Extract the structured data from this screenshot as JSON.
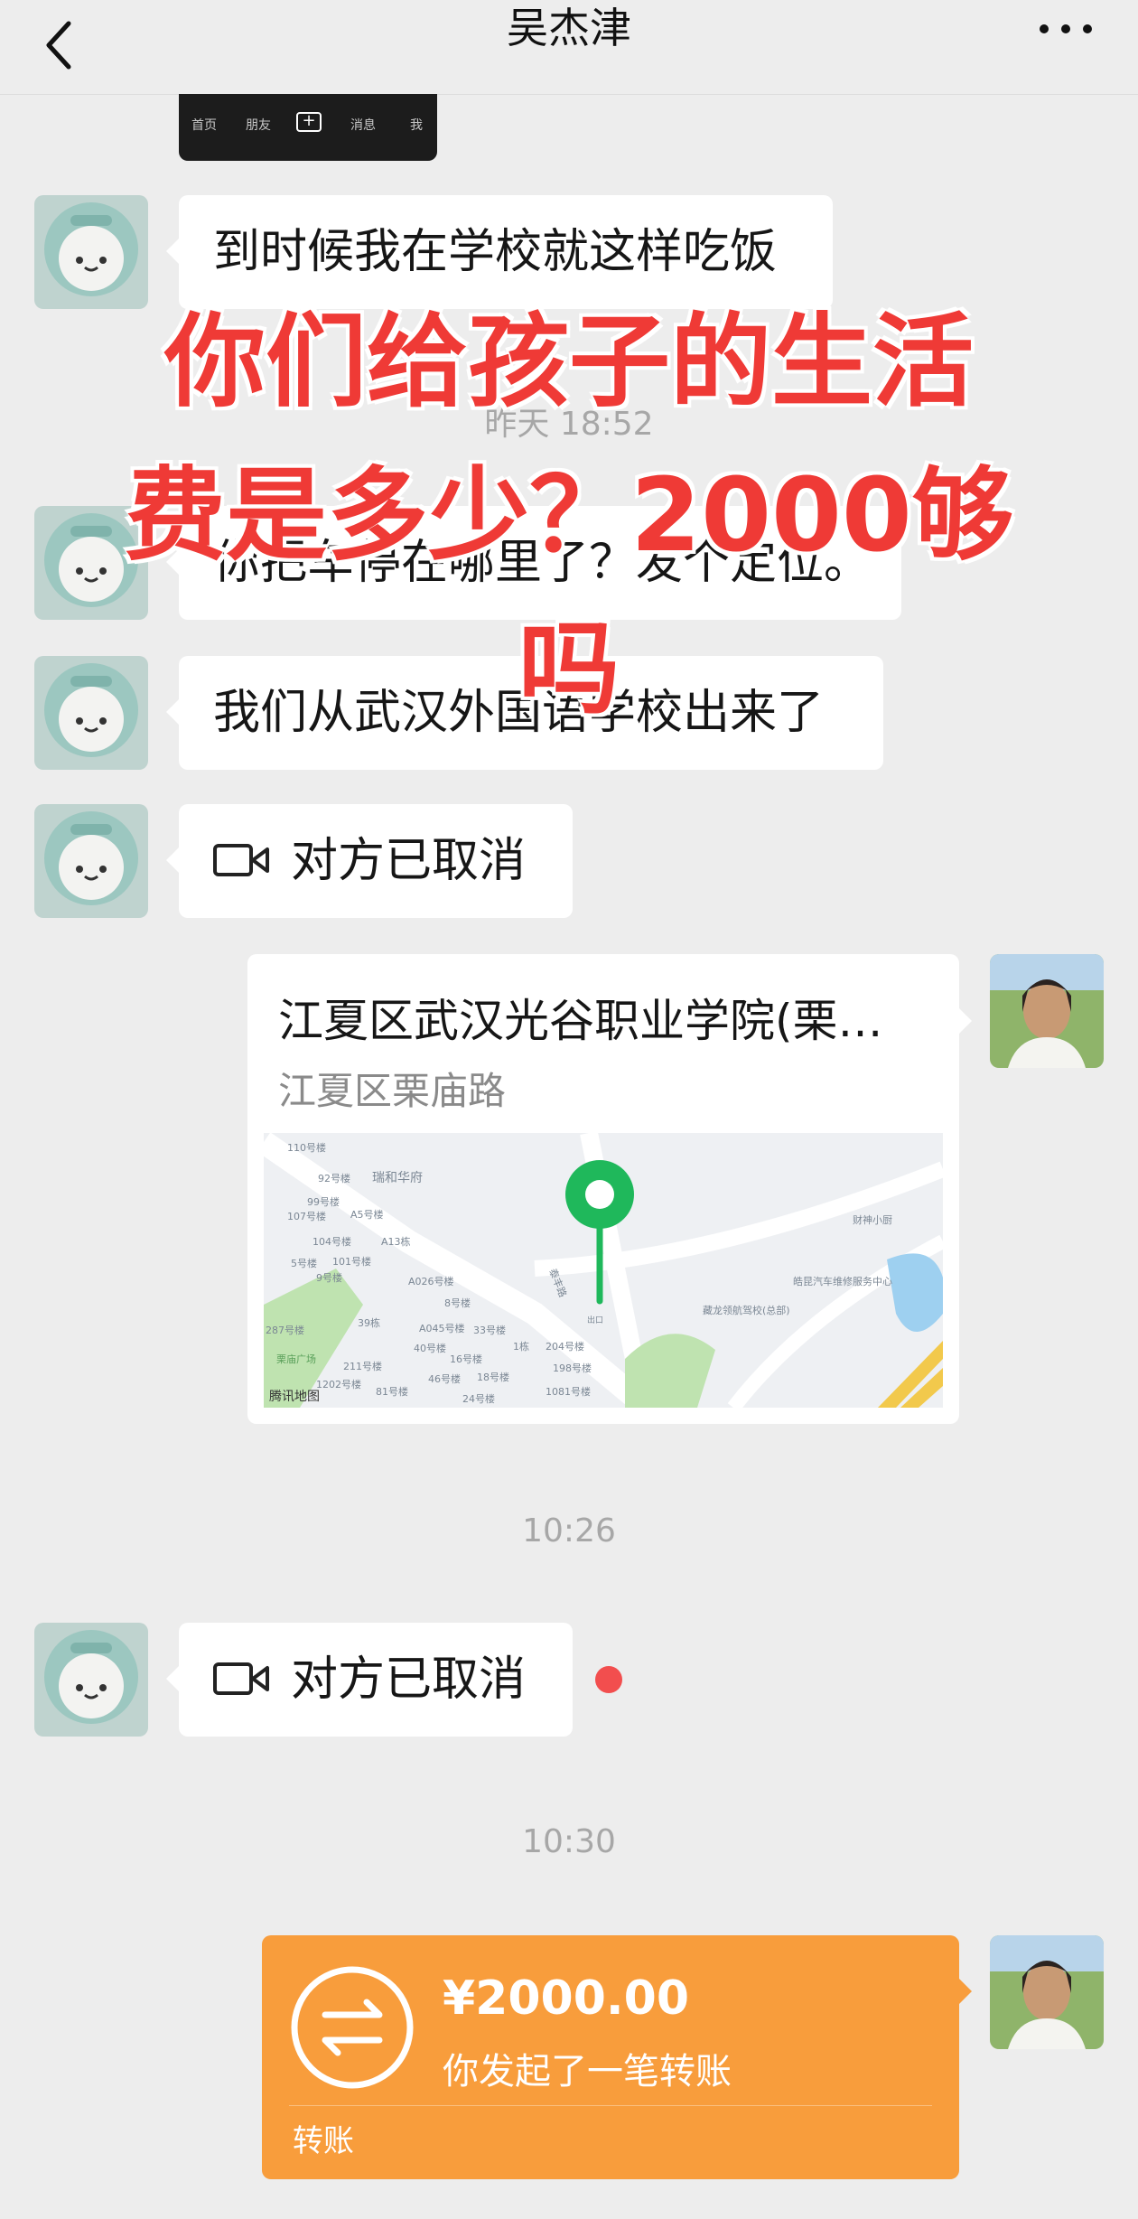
{
  "header": {
    "title": "吴杰津"
  },
  "shot_tabs": [
    "首页",
    "朋友",
    "消息",
    "我"
  ],
  "messages": {
    "m1": "到时候我在学校就这样吃饭",
    "m2": "你把车停在哪里了？发个定位。",
    "m3": "我们从武汉外国语学校出来了",
    "m4": "对方已取消",
    "m5": "对方已取消"
  },
  "times": {
    "t1": "昨天 18:52",
    "t2": "10:26",
    "t3": "10:30"
  },
  "location": {
    "name": "江夏区武汉光谷职业学院(栗…",
    "address": "江夏区栗庙路",
    "map_labels": [
      "110号楼",
      "92号楼",
      "瑞和华府",
      "99号楼",
      "107号楼",
      "A5号楼",
      "104号楼",
      "A13栋",
      "5号楼",
      "101号楼",
      "9号楼",
      "A026号楼",
      "8号楼",
      "287号楼",
      "39栋",
      "A045号楼",
      "33号楼",
      "栗庙广场",
      "211号楼",
      "40号楼",
      "16号楼",
      "1栋",
      "204号楼",
      "198号楼",
      "46号楼",
      "18号楼",
      "1202号楼",
      "81号楼",
      "24号楼",
      "1081号楼",
      "泰丰路",
      "藏龙领航驾校(总部)",
      "皓昆汽车维修服务中心",
      "财神小厨",
      "出口"
    ],
    "map_brand": "腾讯地图"
  },
  "overlay": {
    "line1": "你们给孩子的生活",
    "line2": "费是多少？2000够",
    "line3": "吗"
  },
  "transfer": {
    "amount": "¥2000.00",
    "description": "你发起了一笔转账",
    "label": "转账"
  },
  "colors": {
    "background": "#ededed",
    "bubble": "#ffffff",
    "transfer": "#f89d3c",
    "overlay_text": "#ef3a36",
    "map_pin": "#1fb85b",
    "unread_dot": "#f24e4e"
  },
  "icons": {
    "back": "chevron-left-icon",
    "more": "more-dots-icon",
    "video": "video-camera-icon",
    "transfer": "transfer-arrows-icon",
    "pin": "map-pin-icon"
  }
}
